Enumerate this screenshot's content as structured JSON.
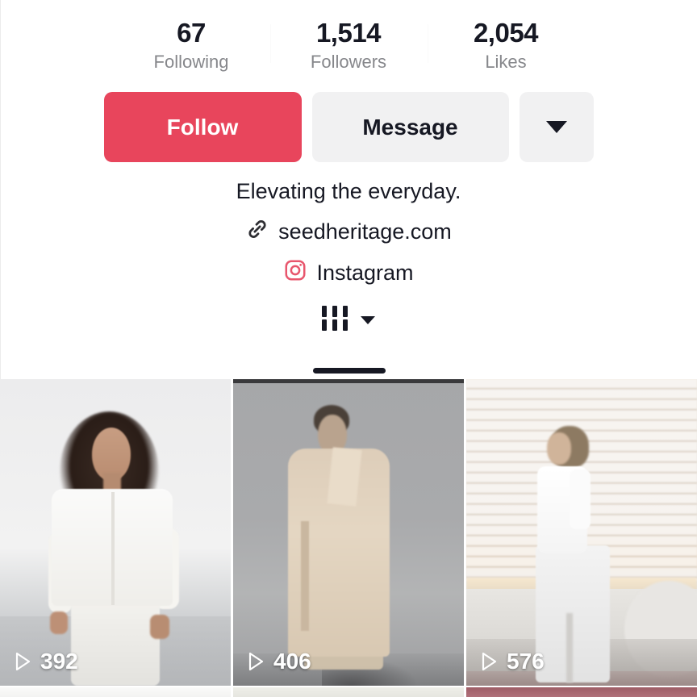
{
  "profile": {
    "stats": [
      {
        "value": "67",
        "label": "Following",
        "name": "following"
      },
      {
        "value": "1,514",
        "label": "Followers",
        "name": "followers"
      },
      {
        "value": "2,054",
        "label": "Likes",
        "name": "likes"
      }
    ],
    "actions": {
      "follow_label": "Follow",
      "message_label": "Message",
      "more_icon": "chevron-down-icon",
      "follow_color": "#e8455c",
      "secondary_color": "#f1f1f2"
    },
    "bio": "Elevating the everyday.",
    "website": {
      "icon": "link-icon",
      "label": "seedheritage.com"
    },
    "social": {
      "icon": "instagram-icon",
      "label": "Instagram",
      "icon_color": "#e8566d"
    }
  },
  "tabs": [
    {
      "name": "videos-tab",
      "icon": "grid-icon",
      "caret": "chevron-down-icon",
      "active": true
    }
  ],
  "videos": [
    {
      "name": "video-thumbnail-1",
      "views": "392",
      "play_icon": "play-icon",
      "description": "Woman in white linen shirt and trousers in pale studio"
    },
    {
      "name": "video-thumbnail-2",
      "views": "406",
      "play_icon": "play-icon",
      "description": "Model in beige trench coat against grey wall"
    },
    {
      "name": "video-thumbnail-3",
      "views": "576",
      "play_icon": "play-icon",
      "description": "Person in white outfit walking past light brick wall"
    }
  ]
}
